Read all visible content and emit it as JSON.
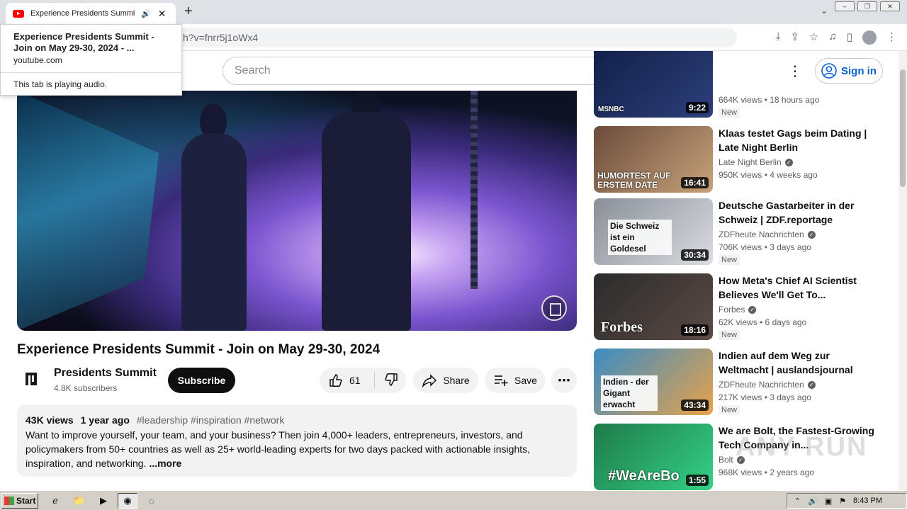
{
  "browser": {
    "tab_title": "Experience Presidents Summit -",
    "url": "h?v=fnrr5j1oWx4",
    "popup": {
      "title": "Experience Presidents Summit - Join on May 29-30, 2024 - ...",
      "domain": "youtube.com",
      "audio_note": "This tab is playing audio."
    }
  },
  "header": {
    "search_placeholder": "Search",
    "signin_label": "Sign in"
  },
  "video": {
    "title": "Experience Presidents Summit - Join on May 29-30, 2024",
    "channel": "Presidents Summit",
    "subscribers": "4.8K subscribers",
    "subscribe_label": "Subscribe",
    "likes": "61",
    "share_label": "Share",
    "save_label": "Save",
    "views": "43K views",
    "age": "1 year ago",
    "tags": "#leadership #inspiration #network",
    "description": "Want to improve yourself, your team, and your business? Then join 4,000+ leaders, entrepreneurs, investors, and policymakers from 50+ countries as well as 25+ world-leading experts for two days packed with actionable insights, inspiration, and networking.",
    "more_label": "...more"
  },
  "recommendations": [
    {
      "title": "",
      "channel": "",
      "stats": "664K views • 18 hours ago",
      "badge": "New",
      "duration": "9:22",
      "thumb_text": "MSNBC",
      "colors": [
        "#12204a",
        "#2c3f7a"
      ]
    },
    {
      "title": "Klaas testet Gags beim Dating | Late Night Berlin",
      "channel": "Late Night Berlin",
      "stats": "950K views • 4 weeks ago",
      "badge": "",
      "duration": "16:41",
      "thumb_text": "HUMORTEST AUF ERSTEM DATE",
      "colors": [
        "#6b4b3a",
        "#c7a27a"
      ]
    },
    {
      "title": "Deutsche Gastarbeiter in der Schweiz | ZDF.reportage",
      "channel": "ZDFheute Nachrichten",
      "stats": "706K views • 3 days ago",
      "badge": "New",
      "duration": "30:34",
      "thumb_text": "Die Schweiz ist ein Goldesel",
      "colors": [
        "#8a8f96",
        "#d9dde2"
      ]
    },
    {
      "title": "How Meta's Chief AI Scientist Believes We'll Get To...",
      "channel": "Forbes",
      "stats": "62K views • 6 days ago",
      "badge": "New",
      "duration": "18:16",
      "thumb_text": "Forbes",
      "colors": [
        "#2b2b2b",
        "#5a4a44"
      ]
    },
    {
      "title": "Indien auf dem Weg zur Weltmacht | auslandsjournal",
      "channel": "ZDFheute Nachrichten",
      "stats": "217K views • 3 days ago",
      "badge": "New",
      "duration": "43:34",
      "thumb_text": "Indien - der Gigant erwacht",
      "colors": [
        "#3a8cc4",
        "#e8a24a"
      ]
    },
    {
      "title": "We are Bolt, the Fastest-Growing Tech Company in...",
      "channel": "Bolt",
      "stats": "968K views • 2 years ago",
      "badge": "",
      "duration": "1:55",
      "thumb_text": "#WeAreBo",
      "colors": [
        "#1e7a4a",
        "#34d186"
      ]
    }
  ],
  "taskbar": {
    "start_label": "Start",
    "clock": "8:43 PM"
  },
  "watermark": "ANY RUN"
}
